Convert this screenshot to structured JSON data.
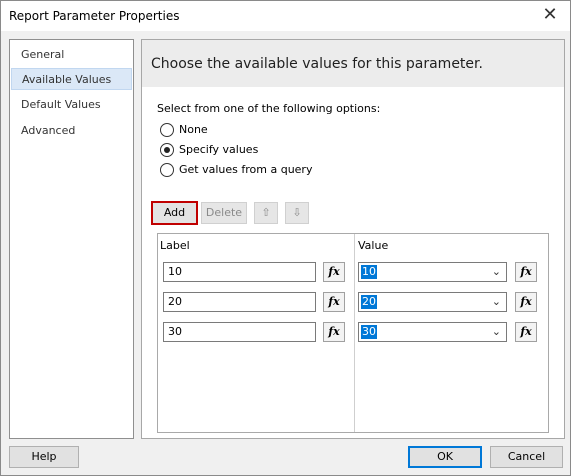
{
  "window": {
    "title": "Report Parameter Properties",
    "close_glyph": "✕"
  },
  "sidebar": {
    "items": [
      {
        "label": "General"
      },
      {
        "label": "Available Values"
      },
      {
        "label": "Default Values"
      },
      {
        "label": "Advanced"
      }
    ]
  },
  "main": {
    "heading": "Choose the available values for this parameter.",
    "options_title": "Select from one of the following options:",
    "options": [
      {
        "label": "None"
      },
      {
        "label": "Specify values"
      },
      {
        "label": "Get values from a query"
      }
    ],
    "toolbar": {
      "add": "Add",
      "delete": "Delete",
      "up_glyph": "⇧",
      "down_glyph": "⇩"
    },
    "grid": {
      "label_header": "Label",
      "value_header": "Value",
      "fx_label": "fx",
      "rows": [
        {
          "label": "10",
          "value": "10"
        },
        {
          "label": "20",
          "value": "20"
        },
        {
          "label": "30",
          "value": "30"
        }
      ]
    }
  },
  "footer": {
    "help": "Help",
    "ok": "OK",
    "cancel": "Cancel"
  }
}
